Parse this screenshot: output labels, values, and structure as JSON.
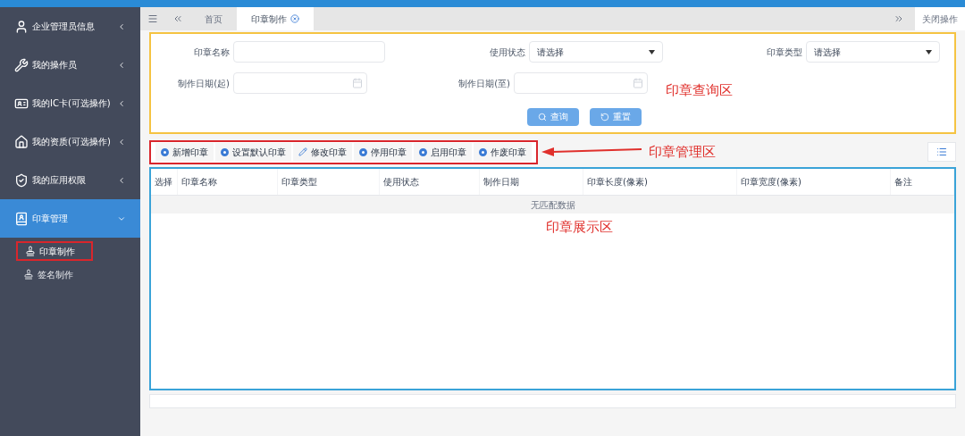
{
  "sidebar": {
    "items": [
      {
        "label": "企业管理员信息"
      },
      {
        "label": "我的操作员"
      },
      {
        "label": "我的IC卡(可选操作)"
      },
      {
        "label": "我的资质(可选操作)"
      },
      {
        "label": "我的应用权限"
      },
      {
        "label": "印章管理",
        "expanded": true,
        "children": [
          {
            "label": "印章制作",
            "selected": true
          },
          {
            "label": "签名制作",
            "selected": false
          }
        ]
      }
    ]
  },
  "tabs": [
    {
      "label": "首页",
      "selected": false
    },
    {
      "label": "印章制作",
      "selected": true
    }
  ],
  "close_menu": "关闭操作",
  "query": {
    "fields": [
      {
        "label": "印章名称",
        "kind": "text"
      },
      {
        "label": "使用状态",
        "kind": "select",
        "value": "请选择"
      },
      {
        "label": "印章类型",
        "kind": "select",
        "value": "请选择"
      },
      {
        "label": "制作日期(起)",
        "kind": "date"
      },
      {
        "label": "制作日期(至)",
        "kind": "date"
      }
    ],
    "buttons": [
      "查询",
      "重置"
    ],
    "annotation": "印章查询区"
  },
  "toolbar": {
    "buttons": [
      "新增印章",
      "设置默认印章",
      "修改印章",
      "停用印章",
      "启用印章",
      "作废印章"
    ],
    "annotation": "印章管理区"
  },
  "table": {
    "columns": [
      "选择",
      "印章名称",
      "印章类型",
      "使用状态",
      "制作日期",
      "印章长度(像素)",
      "印章宽度(像素)",
      "备注"
    ],
    "empty_text": "无匹配数据",
    "annotation": "印章展示区"
  }
}
